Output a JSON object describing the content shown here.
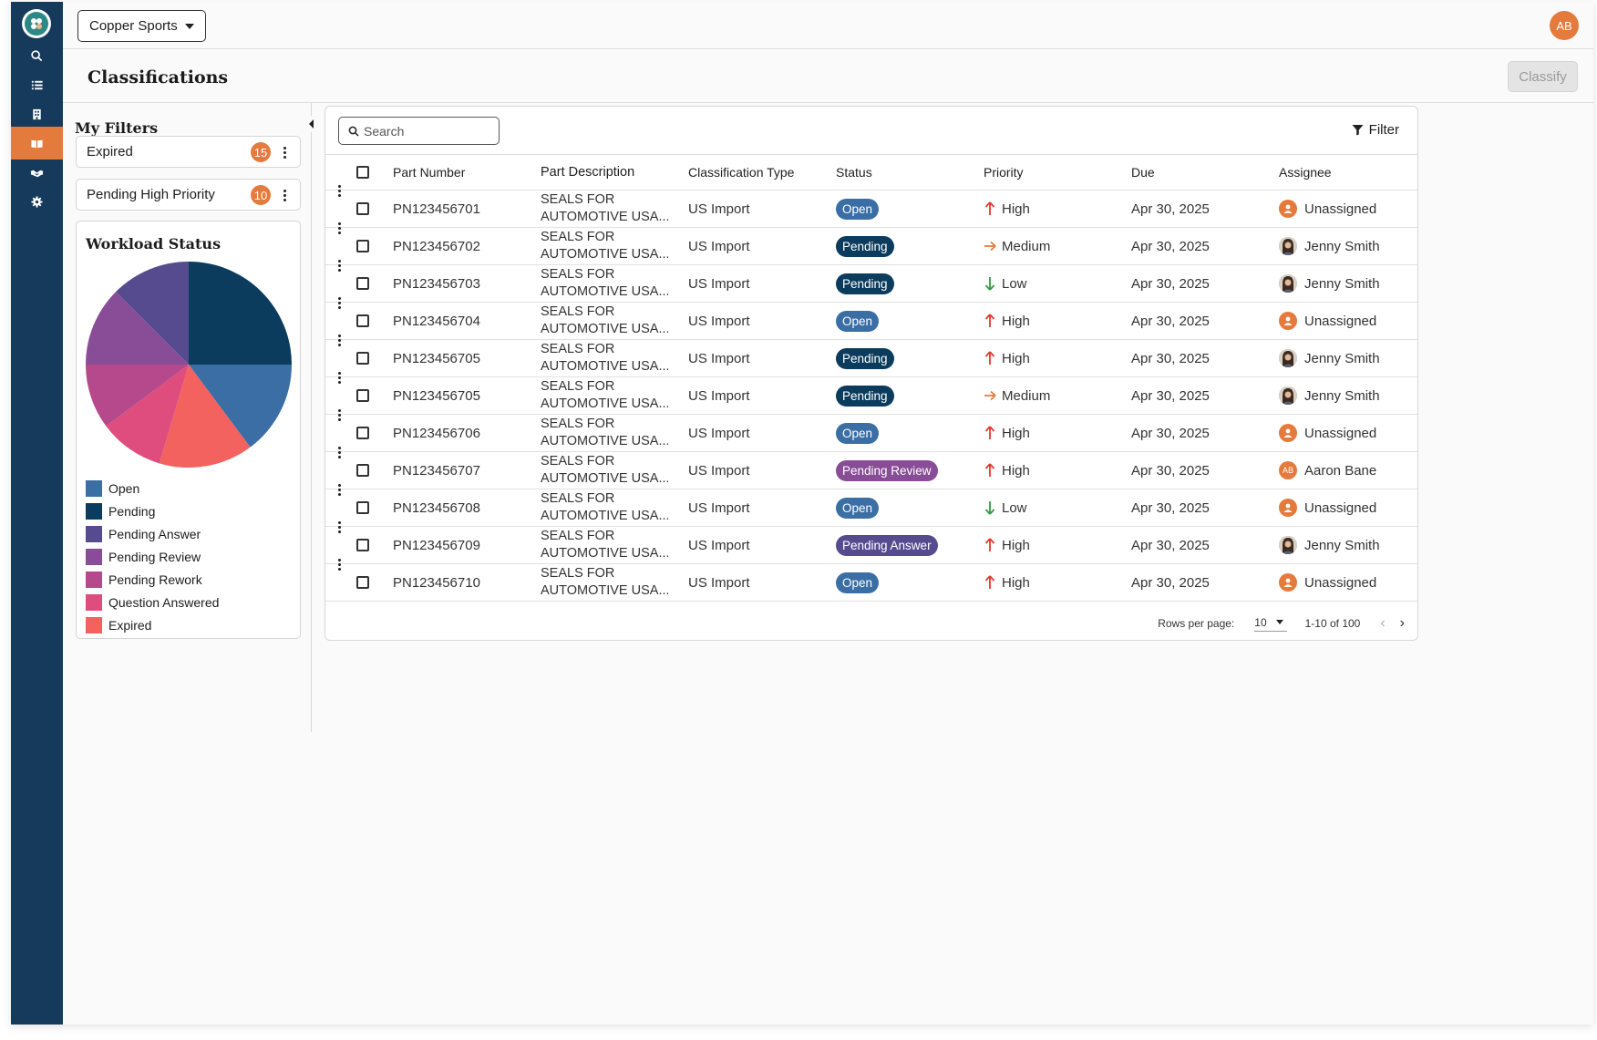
{
  "colors": {
    "sidebar": "#153a5b",
    "accent": "#e57a3d",
    "open": "#3a6ea5",
    "pending": "#0b3c5d",
    "pending_answer": "#574b90",
    "pending_review": "#894c96",
    "pending_rework": "#b5498b",
    "question_answered": "#de4d7d",
    "expired": "#f3625f"
  },
  "sidebar": {
    "items": [
      {
        "name": "search-icon"
      },
      {
        "name": "list-icon"
      },
      {
        "name": "building-icon"
      },
      {
        "name": "book-icon",
        "active": true
      },
      {
        "name": "handshake-icon"
      },
      {
        "name": "gear-icon"
      }
    ]
  },
  "topbar": {
    "company": "Copper Sports",
    "user_initials": "AB"
  },
  "page": {
    "title": "Classifications",
    "classify_label": "Classify"
  },
  "filters": {
    "title": "My Filters",
    "items": [
      {
        "label": "Expired",
        "count": "15"
      },
      {
        "label": "Pending High Priority",
        "count": "10"
      }
    ]
  },
  "workload": {
    "title": "Workload Status",
    "legend": [
      {
        "label": "Open",
        "color": "#3a6ea5"
      },
      {
        "label": "Pending",
        "color": "#0b3c5d"
      },
      {
        "label": "Pending Answer",
        "color": "#574b90"
      },
      {
        "label": "Pending Review",
        "color": "#894c96"
      },
      {
        "label": "Pending Rework",
        "color": "#b5498b"
      },
      {
        "label": "Question Answered",
        "color": "#de4d7d"
      },
      {
        "label": "Expired",
        "color": "#f3625f"
      }
    ],
    "slices": [
      {
        "label": "Pending",
        "value": 25.0,
        "color": "#0b3c5d"
      },
      {
        "label": "Open",
        "value": 14.8,
        "color": "#3a6ea5"
      },
      {
        "label": "Expired",
        "value": 14.8,
        "color": "#f3625f"
      },
      {
        "label": "Question Answered",
        "value": 10.2,
        "color": "#de4d7d"
      },
      {
        "label": "Pending Rework",
        "value": 10.2,
        "color": "#b5498b"
      },
      {
        "label": "Pending Review",
        "value": 12.5,
        "color": "#894c96"
      },
      {
        "label": "Pending Answer",
        "value": 12.5,
        "color": "#574b90"
      }
    ]
  },
  "table": {
    "search_placeholder": "Search",
    "filter_label": "Filter",
    "columns": [
      "Part Number",
      "Part Description",
      "Classification Type",
      "Status",
      "Priority",
      "Due",
      "Assignee"
    ],
    "rows": [
      {
        "part": "PN123456701",
        "desc1": "SEALS FOR",
        "desc2": "AUTOMOTIVE USA...",
        "type": "US Import",
        "status": "Open",
        "status_key": "open",
        "priority": "High",
        "prio_key": "high",
        "due": "Apr 30, 2025",
        "assignee": "Unassigned",
        "av": "unassigned"
      },
      {
        "part": "PN123456702",
        "desc1": "SEALS FOR",
        "desc2": "AUTOMOTIVE USA...",
        "type": "US Import",
        "status": "Pending",
        "status_key": "pending",
        "priority": "Medium",
        "prio_key": "medium",
        "due": "Apr 30, 2025",
        "assignee": "Jenny Smith",
        "av": "photo"
      },
      {
        "part": "PN123456703",
        "desc1": "SEALS FOR",
        "desc2": "AUTOMOTIVE USA...",
        "type": "US Import",
        "status": "Pending",
        "status_key": "pending",
        "priority": "Low",
        "prio_key": "low",
        "due": "Apr 30, 2025",
        "assignee": "Jenny Smith",
        "av": "photo"
      },
      {
        "part": "PN123456704",
        "desc1": "SEALS FOR",
        "desc2": "AUTOMOTIVE USA...",
        "type": "US Import",
        "status": "Open",
        "status_key": "open",
        "priority": "High",
        "prio_key": "high",
        "due": "Apr 30, 2025",
        "assignee": "Unassigned",
        "av": "unassigned"
      },
      {
        "part": "PN123456705",
        "desc1": "SEALS FOR",
        "desc2": "AUTOMOTIVE USA...",
        "type": "US Import",
        "status": "Pending",
        "status_key": "pending",
        "priority": "High",
        "prio_key": "high",
        "due": "Apr 30, 2025",
        "assignee": "Jenny Smith",
        "av": "photo"
      },
      {
        "part": "PN123456705",
        "desc1": "SEALS FOR",
        "desc2": "AUTOMOTIVE USA...",
        "type": "US Import",
        "status": "Pending",
        "status_key": "pending",
        "priority": "Medium",
        "prio_key": "medium",
        "due": "Apr 30, 2025",
        "assignee": "Jenny Smith",
        "av": "photo"
      },
      {
        "part": "PN123456706",
        "desc1": "SEALS FOR",
        "desc2": "AUTOMOTIVE USA...",
        "type": "US Import",
        "status": "Open",
        "status_key": "open",
        "priority": "High",
        "prio_key": "high",
        "due": "Apr 30, 2025",
        "assignee": "Unassigned",
        "av": "unassigned"
      },
      {
        "part": "PN123456707",
        "desc1": "SEALS FOR",
        "desc2": "AUTOMOTIVE USA...",
        "type": "US Import",
        "status": "Pending Review",
        "status_key": "pending_review",
        "priority": "High",
        "prio_key": "high",
        "due": "Apr 30, 2025",
        "assignee": "Aaron Bane",
        "av": "initials",
        "av_text": "AB"
      },
      {
        "part": "PN123456708",
        "desc1": "SEALS FOR",
        "desc2": "AUTOMOTIVE USA...",
        "type": "US Import",
        "status": "Open",
        "status_key": "open",
        "priority": "Low",
        "prio_key": "low",
        "due": "Apr 30, 2025",
        "assignee": "Unassigned",
        "av": "unassigned"
      },
      {
        "part": "PN123456709",
        "desc1": "SEALS FOR",
        "desc2": "AUTOMOTIVE USA...",
        "type": "US Import",
        "status": "Pending Answer",
        "status_key": "pending_answer",
        "priority": "High",
        "prio_key": "high",
        "due": "Apr 30, 2025",
        "assignee": "Jenny Smith",
        "av": "photo"
      },
      {
        "part": "PN123456710",
        "desc1": "SEALS FOR",
        "desc2": "AUTOMOTIVE USA...",
        "type": "US Import",
        "status": "Open",
        "status_key": "open",
        "priority": "High",
        "prio_key": "high",
        "due": "Apr 30, 2025",
        "assignee": "Unassigned",
        "av": "unassigned"
      }
    ]
  },
  "pagination": {
    "rows_per_page_label": "Rows per page:",
    "rows_per_page": "10",
    "range": "1-10 of 100"
  }
}
